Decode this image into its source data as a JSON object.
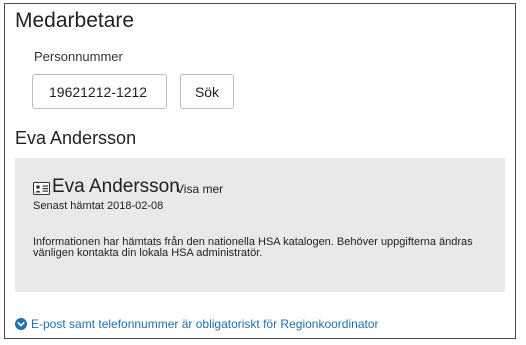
{
  "section": {
    "title": "Medarbetare"
  },
  "search": {
    "label": "Personnummer",
    "value": "19621212-1212",
    "button_label": "Sök"
  },
  "person": {
    "heading": "Eva Andersson",
    "panel_name": "Eva Andersson",
    "more_link": "Visa mer",
    "fetched": "Senast hämtat 2018-02-08",
    "info": "Informationen har hämtats från den nationella HSA katalogen. Behöver uppgifterna ändras vänligen kontakta din lokala HSA administratör."
  },
  "notice": {
    "text": "E-post samt telefonnummer är obligatoriskt för Regionkoordinator",
    "icon": "chevron-down-circle-icon",
    "color": "#1f6fb2"
  },
  "colors": {
    "panel_background": "#e9e9e9",
    "link": "#1f6fb2"
  }
}
